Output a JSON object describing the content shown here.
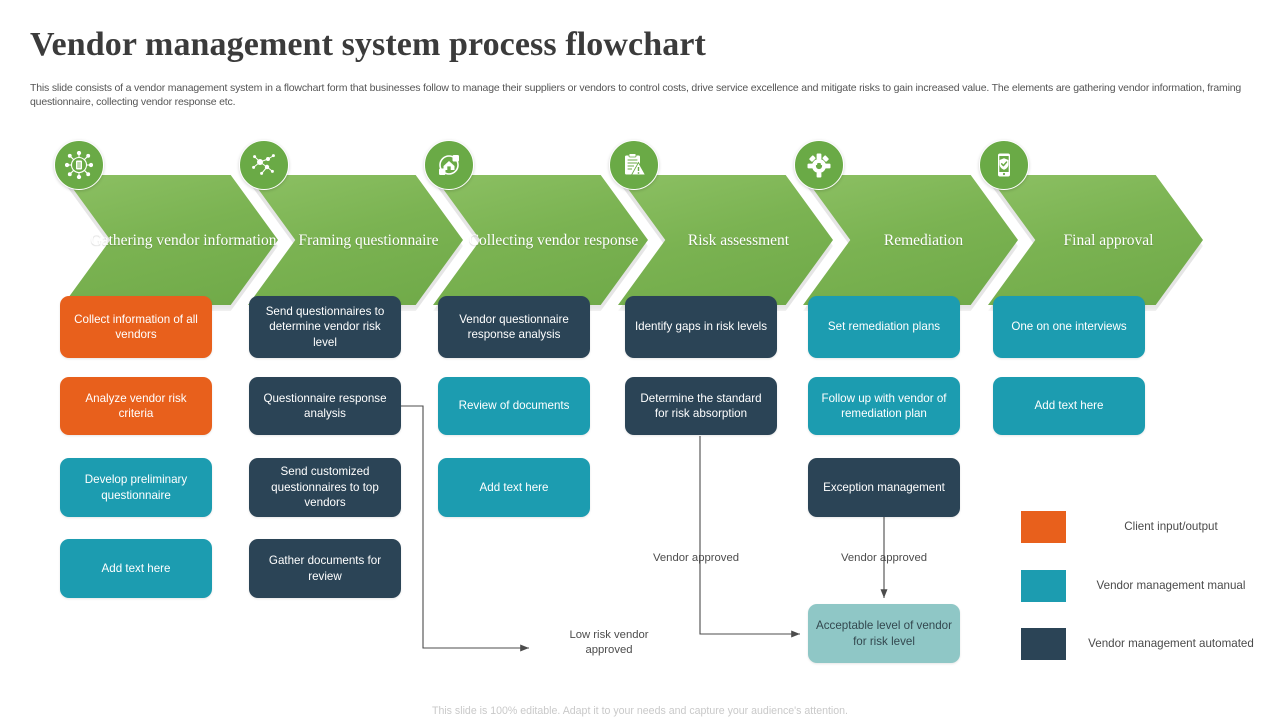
{
  "header": {
    "title": "Vendor management system process flowchart",
    "subtitle": "This slide consists of a vendor management system in a flowchart form that businesses follow to manage their suppliers or vendors to control costs, drive service excellence and mitigate risks to gain increased value. The elements are gathering vendor information, framing questionnaire, collecting vendor response etc."
  },
  "stages": [
    {
      "label": "Gathering vendor information",
      "icon": "network-hub-document-icon"
    },
    {
      "label": "Framing questionnaire",
      "icon": "network-nodes-icon"
    },
    {
      "label": "Collecting vendor response",
      "icon": "data-collection-icon"
    },
    {
      "label": "Risk assessment",
      "icon": "clipboard-warning-icon"
    },
    {
      "label": "Remediation",
      "icon": "gear-settings-icon"
    },
    {
      "label": "Final approval",
      "icon": "mobile-shield-check-icon"
    }
  ],
  "columns": [
    {
      "name": "gathering-vendor-information",
      "boxes": [
        {
          "text": "Collect information of all vendors",
          "color": "orange"
        },
        {
          "text": "Analyze vendor risk criteria",
          "color": "orange"
        },
        {
          "text": "Develop preliminary questionnaire",
          "color": "teal"
        },
        {
          "text": "Add text here",
          "color": "teal"
        }
      ]
    },
    {
      "name": "framing-questionnaire",
      "boxes": [
        {
          "text": "Send questionnaires to determine vendor risk level",
          "color": "navy"
        },
        {
          "text": "Questionnaire response analysis",
          "color": "navy"
        },
        {
          "text": "Send customized questionnaires to top vendors",
          "color": "navy"
        },
        {
          "text": "Gather documents for review",
          "color": "navy"
        }
      ]
    },
    {
      "name": "collecting-vendor-response",
      "boxes": [
        {
          "text": "Vendor questionnaire response analysis",
          "color": "navy"
        },
        {
          "text": "Review of documents",
          "color": "teal"
        },
        {
          "text": "Add text here",
          "color": "teal"
        }
      ]
    },
    {
      "name": "risk-assessment",
      "boxes": [
        {
          "text": "Identify gaps in risk levels",
          "color": "navy"
        },
        {
          "text": "Determine the standard for risk absorption",
          "color": "navy"
        }
      ]
    },
    {
      "name": "remediation",
      "boxes": [
        {
          "text": "Set remediation plans",
          "color": "teal"
        },
        {
          "text": "Follow up with vendor of remediation plan",
          "color": "teal"
        },
        {
          "text": "Exception management",
          "color": "navy"
        }
      ]
    },
    {
      "name": "final-approval",
      "boxes": [
        {
          "text": "One on one interviews",
          "color": "teal"
        },
        {
          "text": "Add text here",
          "color": "teal"
        }
      ]
    }
  ],
  "outcome_box": {
    "text": "Acceptable level of vendor for risk level",
    "color": "mint"
  },
  "edge_labels": {
    "low_risk": "Low risk vendor approved",
    "vendor_approved_risk": "Vendor approved",
    "vendor_approved_remediation": "Vendor approved"
  },
  "legend": [
    {
      "label": "Client input/output",
      "color": "#e8601c"
    },
    {
      "label": "Vendor management manual",
      "color": "#1c9cb0"
    },
    {
      "label": "Vendor management automated",
      "color": "#2b4456"
    }
  ],
  "footer": "This slide is 100% editable. Adapt it to your needs and capture your audience's attention.",
  "colors": {
    "orange": "#e8601c",
    "teal": "#1c9cb0",
    "navy": "#2b4456",
    "mint": "#8fc7c6",
    "green": "#7bb352"
  }
}
